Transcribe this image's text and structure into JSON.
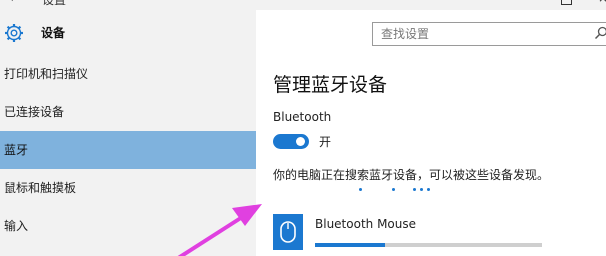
{
  "window": {
    "back_glyph": "‹",
    "title": "设置",
    "close_glyph": "×"
  },
  "sidebar": {
    "title": "设备",
    "items": [
      {
        "label": "打印机和扫描仪",
        "active": false
      },
      {
        "label": "已连接设备",
        "active": false
      },
      {
        "label": "蓝牙",
        "active": true
      },
      {
        "label": "鼠标和触摸板",
        "active": false
      },
      {
        "label": "输入",
        "active": false
      }
    ]
  },
  "search": {
    "placeholder": "查找设置",
    "icon": "search-icon"
  },
  "main": {
    "title": "管理蓝牙设备",
    "bluetooth_label": "Bluetooth",
    "toggle_state": "开",
    "toggle_on": true,
    "status_text": "你的电脑正在搜索蓝牙设备，可以被这些设备发现。"
  },
  "device": {
    "name": "Bluetooth Mouse",
    "icon": "mouse-icon",
    "progress": 0.31
  },
  "colors": {
    "accent": "#1b78d0",
    "sidebar_active": "#7fb2dd",
    "sidebar_bg": "#f2f2f2",
    "annotation_arrow": "#e040e0"
  }
}
